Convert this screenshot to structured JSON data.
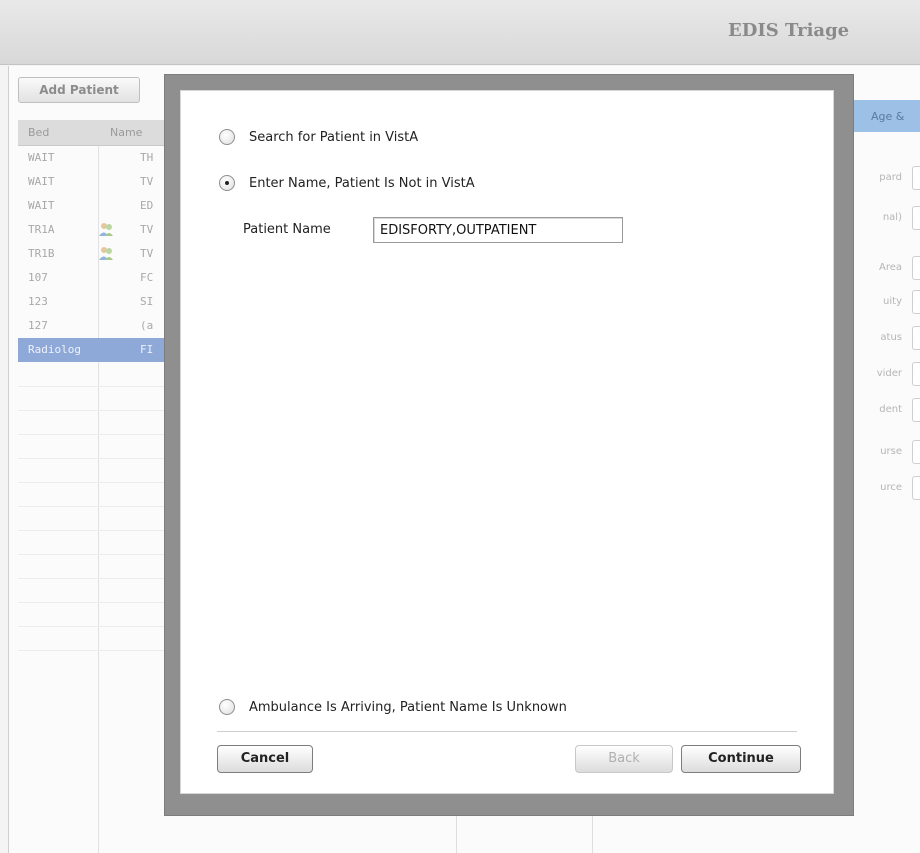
{
  "header": {
    "title": "EDIS Triage"
  },
  "toolbar": {
    "add_patient": "Add Patient"
  },
  "grid": {
    "columns": [
      "Bed",
      "Name"
    ],
    "rows": [
      {
        "bed": "WAIT",
        "name": "TH"
      },
      {
        "bed": "WAIT",
        "name": "TV"
      },
      {
        "bed": "WAIT",
        "name": "ED"
      },
      {
        "bed": "TR1A",
        "name": "TV"
      },
      {
        "bed": "TR1B",
        "name": "TV"
      },
      {
        "bed": "107",
        "name": "FC"
      },
      {
        "bed": "123",
        "name": "SI"
      },
      {
        "bed": "127",
        "name": "(a"
      },
      {
        "bed": "Radiolog",
        "name": "FI"
      }
    ]
  },
  "right_panel": {
    "header": "Age &",
    "labels": [
      "pard",
      "nal)",
      "Area",
      "uity",
      "atus",
      "vider",
      "dent",
      "urse",
      "urce"
    ]
  },
  "dialog": {
    "option_search": "Search for Patient in VistA",
    "option_enter": "Enter Name, Patient Is Not in VistA",
    "option_ambulance": "Ambulance Is Arriving, Patient Name Is Unknown",
    "patient_name_label": "Patient Name",
    "patient_name_value": "EDISFORTY,OUTPATIENT",
    "cancel": "Cancel",
    "back": "Back",
    "continue": "Continue"
  }
}
